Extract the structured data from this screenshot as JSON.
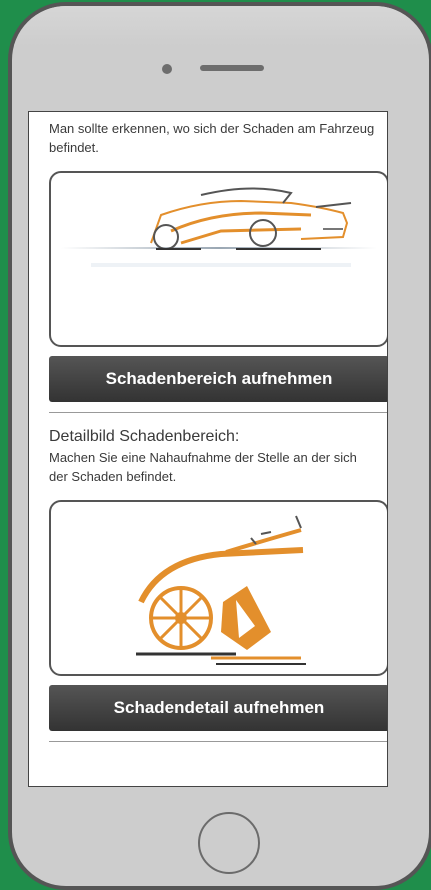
{
  "screen": {
    "intro_text": "Man sollte erkennen, wo sich der Schaden am Fahrzeug befindet.",
    "buttons": {
      "area_label": "Schadenbereich aufnehmen",
      "detail_label": "Schadendetail aufnehmen"
    },
    "detail_section": {
      "title": "Detailbild Schadenbereich:",
      "text": "Machen Sie eine Nahaufnahme der Stelle an der sich der Schaden befindet."
    },
    "images": {
      "area_image": "car-side-illustration",
      "detail_image": "car-front-wheel-closeup-illustration"
    }
  },
  "colors": {
    "background": "#1f8e4b",
    "accent": "#e38f2c",
    "button": "#3f3f3f"
  },
  "icons": {
    "speaker": "speaker-icon",
    "camera": "front-camera-icon",
    "home": "home-button-icon"
  }
}
